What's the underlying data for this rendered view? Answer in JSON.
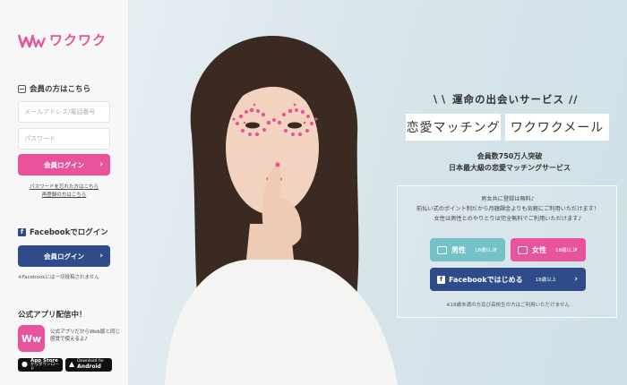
{
  "brand": {
    "logo_text": "ワクワク",
    "logo_mark": "WW",
    "accent": "#e8549b",
    "navy": "#2f4b8a",
    "teal": "#74c2c6"
  },
  "sidebar": {
    "member_title": "会員の方はこちら",
    "email_placeholder": "メールアドレス/電話番号",
    "password_placeholder": "パスワード",
    "login_label": "会員ログイン",
    "forgot_link": "パスワードを忘れた方はこちら",
    "reregister_link": "再登録の方はこちら",
    "fb_title": "Facebookでログイン",
    "fb_login_label": "会員ログイン",
    "fb_note": "※Facebookには一切投稿されません",
    "app_title": "公式アプリ配信中！",
    "app_icon_text": "Ww",
    "app_desc": "公式アプリだからWeb版と同じ感覚で使えるよ♪",
    "appstore_line1": "App Store",
    "appstore_line2": "からダウンロード",
    "android_line1": "Download for",
    "android_line2": "Android"
  },
  "hero": {
    "tagline": "運命の出会いサービス",
    "headline_left": "恋愛マッチング",
    "headline_right": "ワクワクメール",
    "sub_line1": "会員数750万人突破",
    "sub_line2": "日本最大級の恋愛マッチングサービス",
    "panel_line1": "男女共に登録は無料♪",
    "panel_line2": "前払い式のポイント制だから月額課金よりも気軽にご利用いただけます！",
    "panel_line3": "女性は男性とのやりとりは完全無料でご利用いただけます♪",
    "male_label": "男性",
    "male_age": "18歳以上",
    "female_label": "女性",
    "female_age": "18歳以上",
    "fb_start_label": "Facebookではじめる",
    "fb_start_age": "18歳以上",
    "underage_note": "※18歳未満の方及び高校生の方はご利用いただけません"
  }
}
